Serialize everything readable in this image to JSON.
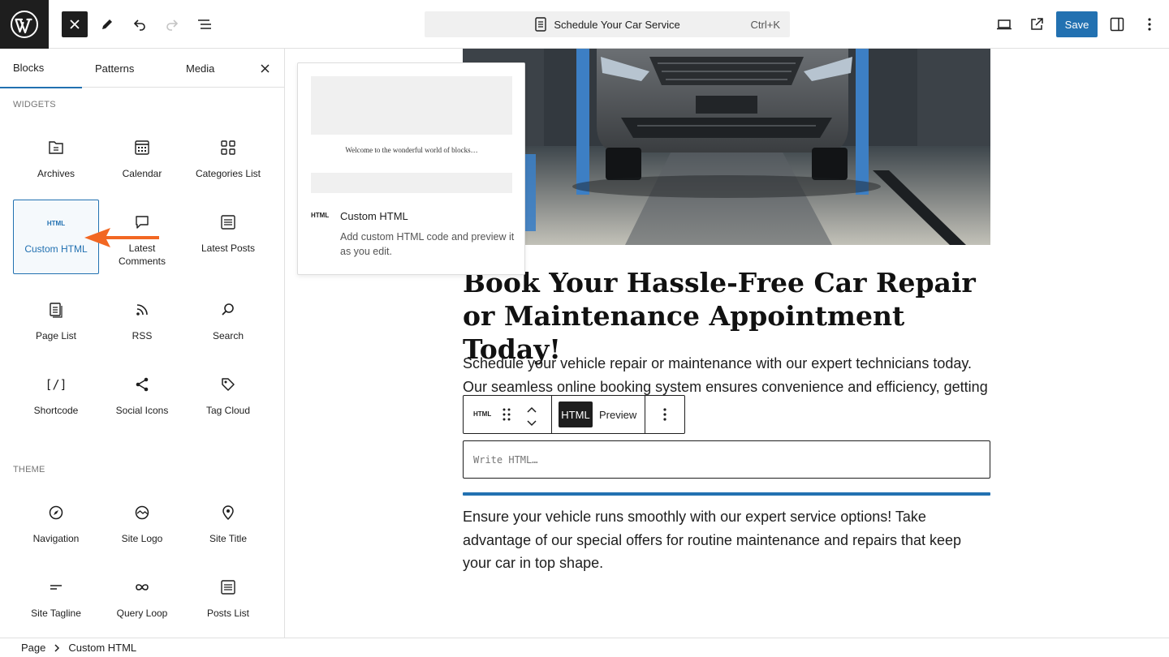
{
  "topbar": {
    "document_title": "Schedule Your Car Service",
    "shortcut": "Ctrl+K",
    "save_label": "Save"
  },
  "inserter": {
    "tabs": [
      "Blocks",
      "Patterns",
      "Media"
    ],
    "sections": [
      {
        "title": "WIDGETS",
        "items": [
          "Archives",
          "Calendar",
          "Categories List",
          "Custom HTML",
          "Latest Comments",
          "Latest Posts",
          "Page List",
          "RSS",
          "Search",
          "Shortcode",
          "Social Icons",
          "Tag Cloud"
        ]
      },
      {
        "title": "THEME",
        "items": [
          "Navigation",
          "Site Logo",
          "Site Title",
          "Site Tagline",
          "Query Loop",
          "Posts List"
        ]
      }
    ],
    "selected_item": "Custom HTML"
  },
  "preview": {
    "sample_text": "Welcome to the wonderful world of blocks…",
    "icon_text": "HTML",
    "title": "Custom HTML",
    "description": "Add custom HTML code and preview it as you edit."
  },
  "content": {
    "headline": "Book Your Hassle-Free Car Repair or Maintenance Appointment Today!",
    "paragraph1": "Schedule your vehicle repair or maintenance with our expert technicians today. Our seamless online booking system ensures convenience and efficiency, getting",
    "block_toolbar": {
      "block_icon": "HTML",
      "html_tab": "HTML",
      "preview_tab": "Preview"
    },
    "html_placeholder": "Write HTML…",
    "paragraph2": "Ensure your vehicle runs smoothly with our expert service options! Take advantage of our special offers for routine maintenance and repairs that keep your car in top shape."
  },
  "breadcrumb": [
    "Page",
    "Custom HTML"
  ],
  "colors": {
    "accent": "#2271b1",
    "dark": "#1e1e1e",
    "arrow": "#f26722"
  }
}
